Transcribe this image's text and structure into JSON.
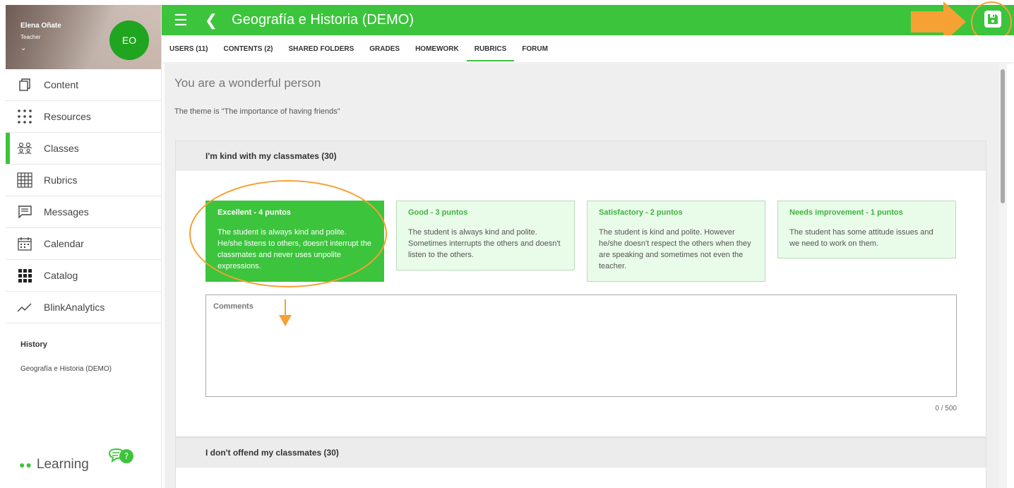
{
  "user": {
    "name": "Elena Oñate",
    "role": "Teacher",
    "initials": "EO"
  },
  "sidebar": {
    "items": [
      {
        "label": "Content",
        "icon": "content-icon"
      },
      {
        "label": "Resources",
        "icon": "grid-dots-icon"
      },
      {
        "label": "Classes",
        "icon": "classes-icon",
        "active": true
      },
      {
        "label": "Rubrics",
        "icon": "rubric-table-icon"
      },
      {
        "label": "Messages",
        "icon": "message-icon"
      },
      {
        "label": "Calendar",
        "icon": "calendar-icon"
      },
      {
        "label": "Catalog",
        "icon": "catalog-icon"
      },
      {
        "label": "BlinkAnalytics",
        "icon": "analytics-icon"
      }
    ],
    "history_title": "History",
    "history_item": "Geografía e Historia (DEMO)",
    "brand": "Learning"
  },
  "header": {
    "title": "Geografía e Historia (DEMO)",
    "accent": "#3cc43c"
  },
  "tabs": [
    {
      "label": "USERS (11)"
    },
    {
      "label": "CONTENTS (2)"
    },
    {
      "label": "SHARED FOLDERS"
    },
    {
      "label": "GRADES"
    },
    {
      "label": "HOMEWORK"
    },
    {
      "label": "RUBRICS",
      "active": true
    },
    {
      "label": "FORUM"
    }
  ],
  "main": {
    "rubric_name": "You are a wonderful person",
    "theme": "The theme is \"The importance of having friends\"",
    "criteria": [
      {
        "title": "I'm kind with my classmates (30)",
        "levels": [
          {
            "title": "Excellent - 4 puntos",
            "desc": "The student is always kind and polite. He/she listens to others, doesn't interrupt the classmates and never uses unpolite expressions.",
            "selected": true
          },
          {
            "title": "Good - 3 puntos",
            "desc": "The student is always kind and polite. Sometimes interrupts the others and doesn't listen to the others."
          },
          {
            "title": "Satisfactory - 2 puntos",
            "desc": "The student is kind and polite. However he/she doesn't respect the others when they are speaking and sometimes not even the teacher."
          },
          {
            "title": "Needs improvement - 1 puntos",
            "desc": "The student has some attitude issues and we need to work on them."
          }
        ],
        "comments_placeholder": "Comments",
        "counter": "0 / 500"
      },
      {
        "title": "I don't offend my classmates (30)"
      }
    ]
  },
  "annotation_color": "#f5a133"
}
